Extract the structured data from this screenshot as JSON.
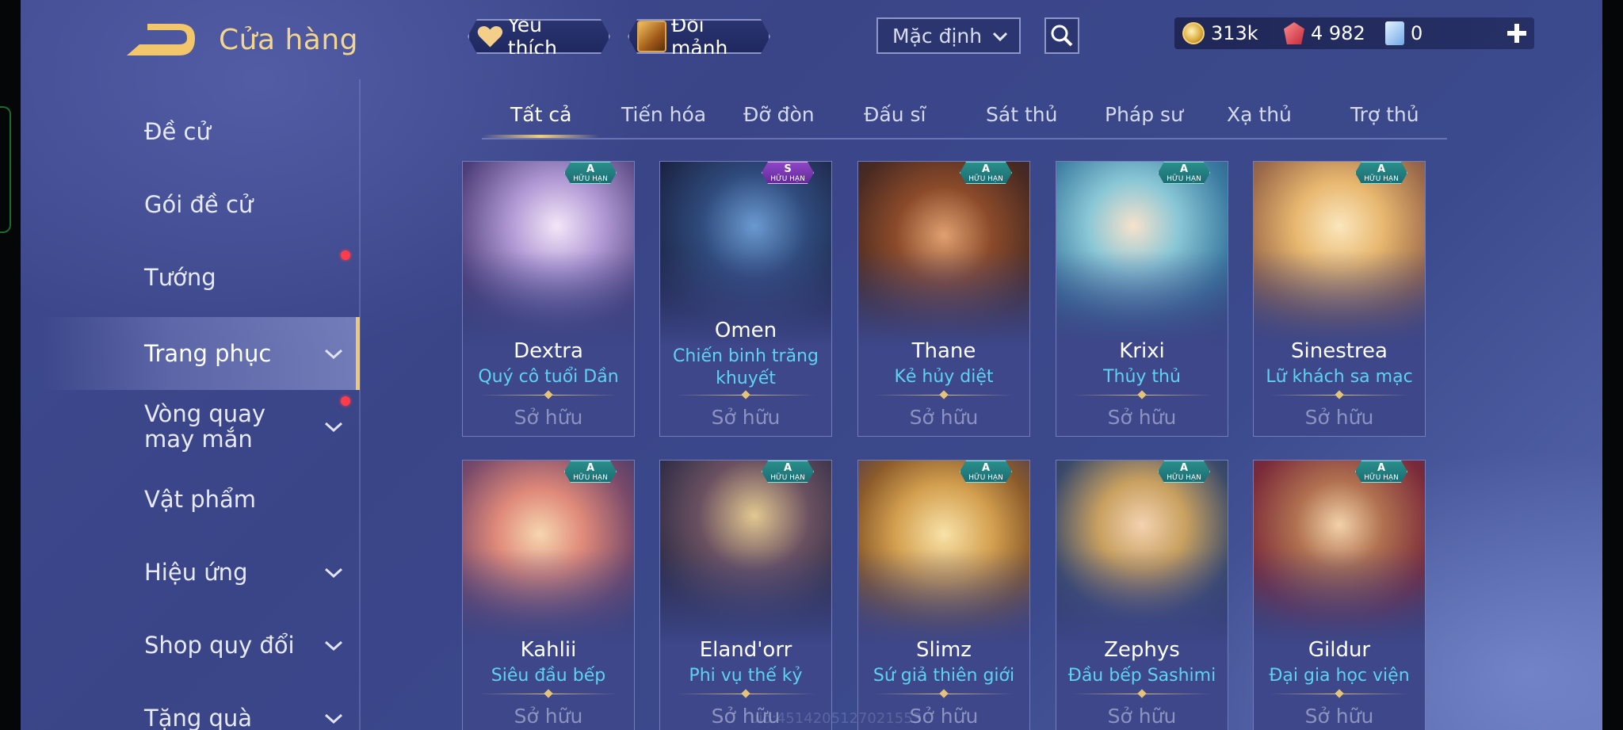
{
  "header": {
    "title": "Cửa hàng",
    "favorite_label": "Yêu thích",
    "shard_label": "Đổi mảnh",
    "sort_value": "Mặc định"
  },
  "currency": {
    "gold": "313k",
    "gems": "4 982",
    "vouchers": "0"
  },
  "sidebar": {
    "items": [
      {
        "label": "Đề cử"
      },
      {
        "label": "Gói đề cử"
      },
      {
        "label": "Tướng"
      },
      {
        "label": "Trang phục"
      },
      {
        "label": "Vòng quay may mắn"
      },
      {
        "label": "Vật phẩm"
      },
      {
        "label": "Hiệu ứng"
      },
      {
        "label": "Shop quy đổi"
      },
      {
        "label": "Tặng quà"
      }
    ]
  },
  "tabs": [
    "Tất cả",
    "Tiến hóa",
    "Đỡ đòn",
    "Đấu sĩ",
    "Sát thủ",
    "Pháp sư",
    "Xạ thủ",
    "Trợ thủ"
  ],
  "cards": [
    {
      "hero": "Dextra",
      "skin": "Quý cô tuổi Dần",
      "status": "Sở hữu",
      "grade": "A",
      "badge": "HỮU HẠN"
    },
    {
      "hero": "Omen",
      "skin": "Chiến binh trăng khuyết",
      "status": "Sở hữu",
      "grade": "S",
      "badge": "HỮU HẠN"
    },
    {
      "hero": "Thane",
      "skin": "Kẻ hủy diệt",
      "status": "Sở hữu",
      "grade": "A",
      "badge": "HỮU HẠN"
    },
    {
      "hero": "Krixi",
      "skin": "Thủy thủ",
      "status": "Sở hữu",
      "grade": "A",
      "badge": "HỮU HẠN"
    },
    {
      "hero": "Sinestrea",
      "skin": "Lữ khách sa mạc",
      "status": "Sở hữu",
      "grade": "A",
      "badge": "HỮU HẠN"
    },
    {
      "hero": "Kahlii",
      "skin": "Siêu đầu bếp",
      "status": "Sở hữu",
      "grade": "A",
      "badge": "HỮU HẠN"
    },
    {
      "hero": "Eland'orr",
      "skin": "Phi vụ thế kỷ",
      "status": "Sở hữu",
      "grade": "A",
      "badge": "HỮU HẠN"
    },
    {
      "hero": "Slimz",
      "skin": "Sứ giả thiên giới",
      "status": "Sở hữu",
      "grade": "A",
      "badge": "HỮU HẠN"
    },
    {
      "hero": "Zephys",
      "skin": "Đầu bếp Sashimi",
      "status": "Sở hữu",
      "grade": "A",
      "badge": "HỮU HẠN"
    },
    {
      "hero": "Gildur",
      "skin": "Đại gia học viện",
      "status": "Sở hữu",
      "grade": "A",
      "badge": "HỮU HẠN"
    }
  ],
  "watermark": "uid:4514205127021553",
  "colors": {
    "accent_gold": "#f2d58e",
    "skin_name": "#5fd2f2",
    "notification": "#ff3c4b"
  }
}
